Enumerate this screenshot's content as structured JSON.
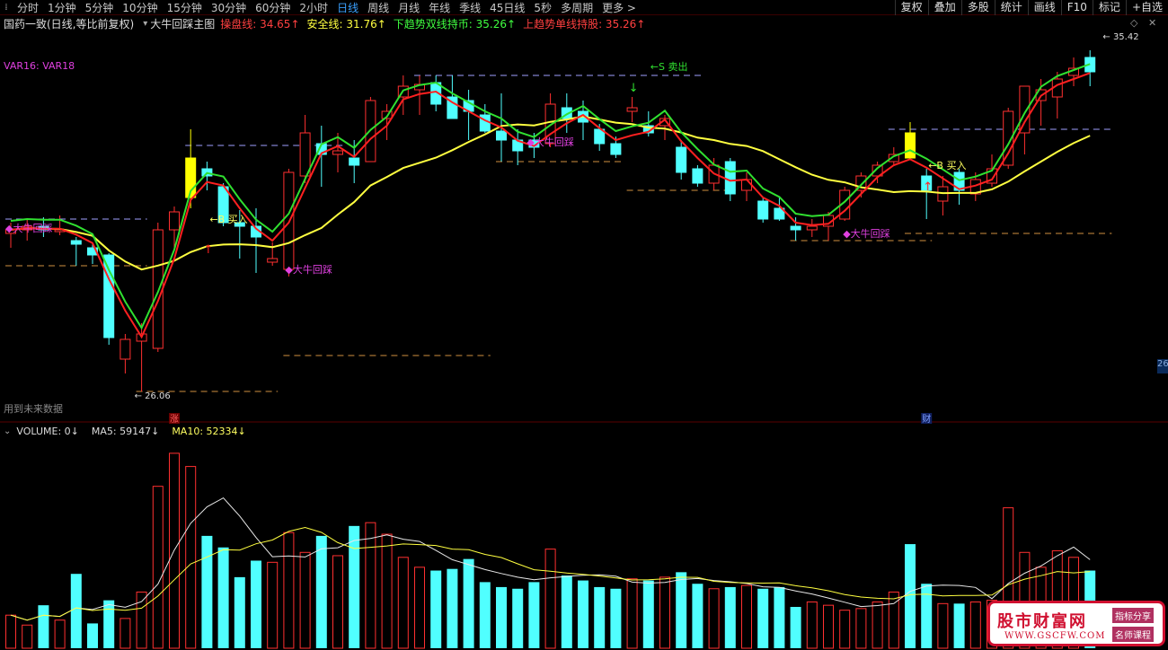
{
  "toolbar": {
    "periods": [
      "分时",
      "1分钟",
      "5分钟",
      "10分钟",
      "15分钟",
      "30分钟",
      "60分钟",
      "2小时",
      "日线",
      "周线",
      "月线",
      "年线",
      "季线",
      "45日线",
      "5秒",
      "多周期",
      "更多 >"
    ],
    "active_period": "日线",
    "right_buttons": [
      "复权",
      "叠加",
      "多股",
      "统计",
      "画线",
      "F10",
      "标记",
      "+自选"
    ]
  },
  "info": {
    "stock": "国药一致(日线,等比前复权)",
    "indicator": "大牛回踩主图",
    "items": [
      {
        "label": "操盘线: 34.65↑",
        "color": "#ff4040"
      },
      {
        "label": "安全线: 31.76↑",
        "color": "#ffff40"
      },
      {
        "label": "下趋势双线持币: 35.26↑",
        "color": "#40ff40"
      },
      {
        "label": "上趋势单线持股: 35.26↑",
        "color": "#ff4040"
      }
    ]
  },
  "legend_var": "VAR16: VAR18",
  "future_label": "用到未来数据",
  "right_badge": "26",
  "price_high_label": "35.42",
  "price_low_label": "26.06",
  "signals": {
    "buy_label": "←B 买入",
    "sell_label": "←S 卖出",
    "buy2_label": "←B 买入",
    "pullback": "大牛回踩",
    "zhang": "涨",
    "cai": "财"
  },
  "volume": {
    "label": "VOLUME: 0↓",
    "ma5": "MA5: 59147↓",
    "ma10": "MA10: 52334↓"
  },
  "colors": {
    "up": "#ff3030",
    "down": "#50ffff",
    "yellow": "#ffff00",
    "green": "#30e030",
    "red": "#ff2020",
    "ma_line": "#ffff40",
    "pullback": "#e040e0",
    "dash": "#a0a0ff",
    "dash_orange": "#d09040"
  },
  "chart_data": {
    "type": "candlestick",
    "ylim": [
      25.5,
      36
    ],
    "candles": [
      {
        "o": 30.5,
        "h": 30.8,
        "l": 30.1,
        "c": 30.6,
        "v": 20000
      },
      {
        "o": 30.6,
        "h": 30.9,
        "l": 30.3,
        "c": 30.7,
        "v": 14000
      },
      {
        "o": 30.7,
        "h": 30.95,
        "l": 30.4,
        "c": 30.6,
        "v": 26000
      },
      {
        "o": 30.55,
        "h": 31.0,
        "l": 30.45,
        "c": 30.6,
        "v": 17000
      },
      {
        "o": 30.3,
        "h": 30.4,
        "l": 29.6,
        "c": 30.2,
        "v": 45000
      },
      {
        "o": 30.1,
        "h": 30.25,
        "l": 29.65,
        "c": 29.9,
        "v": 15000
      },
      {
        "o": 29.9,
        "h": 29.95,
        "l": 27.4,
        "c": 27.6,
        "v": 29000
      },
      {
        "o": 27.0,
        "h": 27.7,
        "l": 26.6,
        "c": 27.55,
        "v": 18000
      },
      {
        "o": 27.5,
        "h": 28.0,
        "l": 26.1,
        "c": 27.7,
        "v": 34000
      },
      {
        "o": 27.3,
        "h": 30.8,
        "l": 27.2,
        "c": 30.6,
        "v": 98000
      },
      {
        "o": 30.6,
        "h": 31.25,
        "l": 30.1,
        "c": 31.1,
        "v": 118000
      },
      {
        "o": 31.5,
        "h": 33.4,
        "l": 31.2,
        "c": 32.6,
        "v": 110000
      },
      {
        "o": 32.3,
        "h": 32.5,
        "l": 31.7,
        "c": 32.1,
        "v": 68000
      },
      {
        "o": 31.8,
        "h": 31.9,
        "l": 30.7,
        "c": 30.8,
        "v": 61000
      },
      {
        "o": 30.8,
        "h": 31.15,
        "l": 29.8,
        "c": 30.7,
        "v": 43000
      },
      {
        "o": 30.7,
        "h": 31.2,
        "l": 29.4,
        "c": 30.4,
        "v": 53000
      },
      {
        "o": 29.7,
        "h": 30.25,
        "l": 29.6,
        "c": 29.8,
        "v": 52000
      },
      {
        "o": 29.5,
        "h": 32.3,
        "l": 29.3,
        "c": 32.2,
        "v": 70000
      },
      {
        "o": 32.1,
        "h": 33.8,
        "l": 31.9,
        "c": 33.3,
        "v": 58000
      },
      {
        "o": 33.0,
        "h": 33.5,
        "l": 31.8,
        "c": 32.7,
        "v": 68000
      },
      {
        "o": 32.7,
        "h": 33.3,
        "l": 32.2,
        "c": 32.8,
        "v": 56000
      },
      {
        "o": 32.6,
        "h": 33.1,
        "l": 31.9,
        "c": 32.4,
        "v": 74000
      },
      {
        "o": 32.5,
        "h": 34.3,
        "l": 32.5,
        "c": 34.2,
        "v": 76000
      },
      {
        "o": 33.7,
        "h": 34.1,
        "l": 33.1,
        "c": 33.9,
        "v": 69000
      },
      {
        "o": 34.3,
        "h": 34.9,
        "l": 33.8,
        "c": 34.6,
        "v": 55000
      },
      {
        "o": 34.5,
        "h": 34.9,
        "l": 33.8,
        "c": 34.65,
        "v": 49000
      },
      {
        "o": 34.7,
        "h": 34.9,
        "l": 33.9,
        "c": 34.1,
        "v": 47000
      },
      {
        "o": 34.3,
        "h": 34.9,
        "l": 33.7,
        "c": 33.7,
        "v": 48000
      },
      {
        "o": 34.2,
        "h": 34.5,
        "l": 33.1,
        "c": 33.9,
        "v": 54000
      },
      {
        "o": 33.8,
        "h": 34.1,
        "l": 33.3,
        "c": 33.35,
        "v": 40000
      },
      {
        "o": 33.35,
        "h": 34.4,
        "l": 32.5,
        "c": 33.1,
        "v": 37000
      },
      {
        "o": 33.1,
        "h": 33.4,
        "l": 32.4,
        "c": 32.8,
        "v": 36000
      },
      {
        "o": 33.1,
        "h": 33.3,
        "l": 32.6,
        "c": 32.9,
        "v": 40000
      },
      {
        "o": 33.0,
        "h": 34.4,
        "l": 32.9,
        "c": 34.1,
        "v": 60000
      },
      {
        "o": 34.0,
        "h": 34.4,
        "l": 33.3,
        "c": 33.7,
        "v": 44000
      },
      {
        "o": 33.9,
        "h": 34.2,
        "l": 33.1,
        "c": 33.6,
        "v": 41000
      },
      {
        "o": 33.4,
        "h": 33.55,
        "l": 32.8,
        "c": 33.0,
        "v": 37000
      },
      {
        "o": 33.0,
        "h": 33.2,
        "l": 32.6,
        "c": 32.7,
        "v": 36000
      },
      {
        "o": 33.9,
        "h": 34.3,
        "l": 33.6,
        "c": 34.0,
        "v": 42000
      },
      {
        "o": 33.5,
        "h": 33.9,
        "l": 33.2,
        "c": 33.3,
        "v": 41000
      },
      {
        "o": 33.5,
        "h": 33.8,
        "l": 33.1,
        "c": 33.7,
        "v": 43000
      },
      {
        "o": 32.9,
        "h": 33.1,
        "l": 32.0,
        "c": 32.2,
        "v": 46000
      },
      {
        "o": 32.3,
        "h": 32.4,
        "l": 31.8,
        "c": 31.9,
        "v": 39000
      },
      {
        "o": 31.9,
        "h": 32.6,
        "l": 31.7,
        "c": 32.4,
        "v": 36000
      },
      {
        "o": 32.5,
        "h": 32.6,
        "l": 31.4,
        "c": 31.6,
        "v": 37000
      },
      {
        "o": 31.7,
        "h": 32.2,
        "l": 31.4,
        "c": 32.0,
        "v": 38000
      },
      {
        "o": 31.4,
        "h": 31.5,
        "l": 30.8,
        "c": 30.9,
        "v": 36000
      },
      {
        "o": 31.2,
        "h": 31.5,
        "l": 30.85,
        "c": 30.9,
        "v": 37000
      },
      {
        "o": 30.7,
        "h": 30.95,
        "l": 30.3,
        "c": 30.6,
        "v": 25000
      },
      {
        "o": 30.6,
        "h": 30.9,
        "l": 30.4,
        "c": 30.7,
        "v": 28000
      },
      {
        "o": 30.7,
        "h": 31.1,
        "l": 30.3,
        "c": 31.0,
        "v": 26000
      },
      {
        "o": 30.9,
        "h": 31.8,
        "l": 30.85,
        "c": 31.7,
        "v": 23000
      },
      {
        "o": 31.7,
        "h": 32.2,
        "l": 31.5,
        "c": 32.1,
        "v": 24000
      },
      {
        "o": 32.1,
        "h": 32.5,
        "l": 31.9,
        "c": 32.4,
        "v": 28000
      },
      {
        "o": 32.5,
        "h": 32.9,
        "l": 32.4,
        "c": 32.7,
        "v": 34000
      },
      {
        "o": 33.3,
        "h": 33.6,
        "l": 32.6,
        "c": 32.6,
        "v": 63000
      },
      {
        "o": 32.1,
        "h": 32.3,
        "l": 30.9,
        "c": 31.7,
        "v": 39000
      },
      {
        "o": 31.4,
        "h": 32.1,
        "l": 31.0,
        "c": 31.8,
        "v": 27000
      },
      {
        "o": 32.2,
        "h": 32.3,
        "l": 31.3,
        "c": 31.7,
        "v": 27000
      },
      {
        "o": 31.6,
        "h": 32.2,
        "l": 31.4,
        "c": 32.0,
        "v": 28000
      },
      {
        "o": 31.9,
        "h": 32.7,
        "l": 31.8,
        "c": 32.3,
        "v": 29000
      },
      {
        "o": 32.4,
        "h": 34.0,
        "l": 32.3,
        "c": 33.9,
        "v": 85000
      },
      {
        "o": 33.3,
        "h": 34.6,
        "l": 32.7,
        "c": 34.6,
        "v": 58000
      },
      {
        "o": 34.2,
        "h": 34.8,
        "l": 33.5,
        "c": 34.5,
        "v": 49000
      },
      {
        "o": 34.3,
        "h": 35.0,
        "l": 33.7,
        "c": 34.8,
        "v": 59000
      },
      {
        "o": 34.9,
        "h": 35.4,
        "l": 34.6,
        "c": 35.1,
        "v": 55000
      },
      {
        "o": 35.4,
        "h": 35.6,
        "l": 34.6,
        "c": 35.0,
        "v": 47000
      }
    ]
  }
}
